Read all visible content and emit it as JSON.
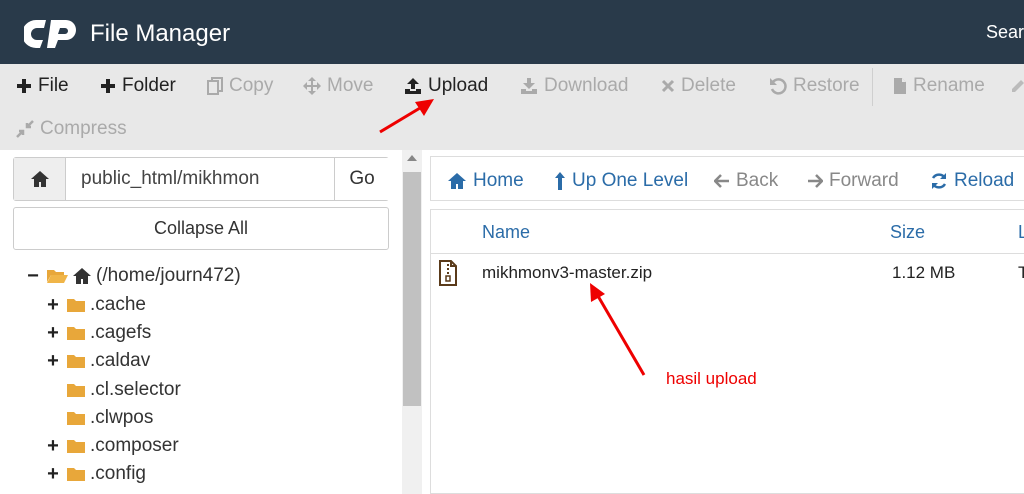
{
  "header": {
    "title": "File Manager",
    "search_partial": "Sear",
    "logo_icon": "cpanel-logo-icon"
  },
  "toolbar": {
    "row1": [
      {
        "label": "File",
        "icon": "plus-icon",
        "enabled": true
      },
      {
        "label": "Folder",
        "icon": "plus-icon",
        "enabled": true
      },
      {
        "label": "Copy",
        "icon": "copy-icon",
        "enabled": false
      },
      {
        "label": "Move",
        "icon": "move-icon",
        "enabled": false
      },
      {
        "label": "Upload",
        "icon": "upload-icon",
        "enabled": true
      },
      {
        "label": "Download",
        "icon": "download-icon",
        "enabled": false
      },
      {
        "label": "Delete",
        "icon": "close-icon",
        "enabled": false
      },
      {
        "label": "Restore",
        "icon": "undo-icon",
        "enabled": false
      },
      {
        "label": "Rename",
        "icon": "file-icon",
        "enabled": false
      }
    ],
    "row2": [
      {
        "label": "Compress",
        "icon": "compress-icon",
        "enabled": false
      }
    ]
  },
  "sidebar": {
    "path_value": "public_html/mikhmon",
    "go_label": "Go",
    "collapse_label": "Collapse All",
    "tree": [
      {
        "toggle": "−",
        "label": "(/home/journ472)",
        "icon": "folder-open-icon",
        "home": true
      },
      {
        "toggle": "+",
        "label": ".cache",
        "icon": "folder-icon"
      },
      {
        "toggle": "+",
        "label": ".cagefs",
        "icon": "folder-icon"
      },
      {
        "toggle": "+",
        "label": ".caldav",
        "icon": "folder-icon"
      },
      {
        "toggle": "",
        "label": ".cl.selector",
        "icon": "folder-icon"
      },
      {
        "toggle": "",
        "label": ".clwpos",
        "icon": "folder-icon"
      },
      {
        "toggle": "+",
        "label": ".composer",
        "icon": "folder-icon"
      },
      {
        "toggle": "+",
        "label": ".config",
        "icon": "folder-icon"
      }
    ]
  },
  "nav": {
    "home": "Home",
    "up": "Up One Level",
    "back": "Back",
    "forward": "Forward",
    "reload": "Reload"
  },
  "table": {
    "columns": [
      "Name",
      "Size",
      "L"
    ],
    "rows": [
      {
        "name": "mikhmonv3-master.zip",
        "size": "1.12 MB",
        "extra": "T",
        "icon": "zip-file-icon"
      }
    ]
  },
  "annotation": {
    "text": "hasil upload",
    "color": "#e00000"
  },
  "colors": {
    "header_bg": "#293a4a",
    "toolbar_bg": "#e8e8e8",
    "link": "#2b6ca8",
    "folder": "#e8a73a"
  }
}
